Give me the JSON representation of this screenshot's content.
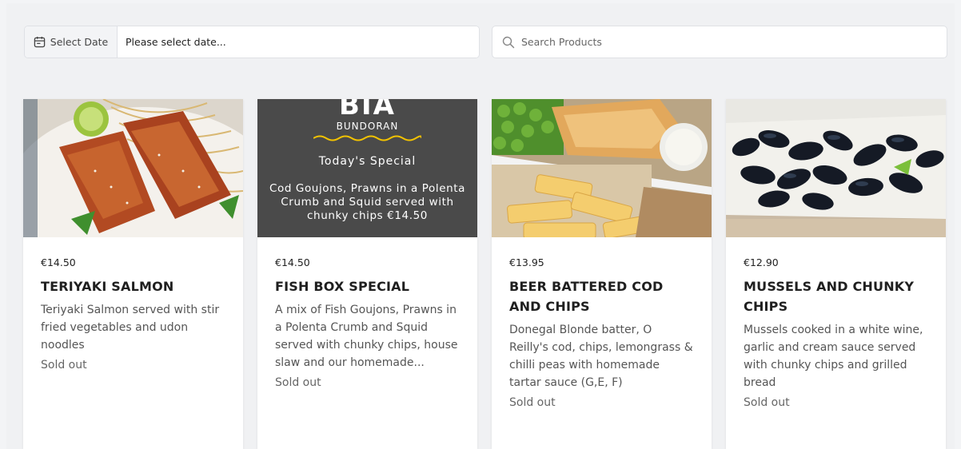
{
  "toolbar": {
    "date_label": "Select Date",
    "date_placeholder": "Please select date...",
    "search_placeholder": "Search Products"
  },
  "products": [
    {
      "price": "€14.50",
      "title": "TERIYAKI SALMON",
      "description": "Teriyaki Salmon served with stir fried vegetables and udon noodles",
      "status": "Sold out"
    },
    {
      "price": "€14.50",
      "title": "FISH BOX SPECIAL",
      "description": "A mix of Fish Goujons, Prawns in a Polenta Crumb and Squid served with chunky chips, house slaw and our homemade...",
      "status": "Sold out",
      "image_text": {
        "logo": "BIA",
        "location": "BUNDORAN",
        "heading": "Today's Special",
        "body": "Cod Goujons, Prawns in a Polenta Crumb and Squid served with chunky chips €14.50"
      }
    },
    {
      "price": "€13.95",
      "title": "BEER BATTERED COD AND CHIPS",
      "description": "Donegal Blonde batter, O Reilly's cod, chips, lemongrass & chilli peas with homemade tartar sauce (G,E, F)",
      "status": "Sold out"
    },
    {
      "price": "€12.90",
      "title": "MUSSELS AND CHUNKY CHIPS",
      "description": "Mussels cooked in a white wine, garlic and cream sauce served with chunky chips and grilled bread",
      "status": "Sold out"
    }
  ],
  "colors": {
    "page_bg": "#f0f1f3",
    "card_bg": "#ffffff",
    "special_board": "#4a4a4a",
    "wave_yellow": "#f2c200"
  },
  "icons": [
    "calendar-icon",
    "search-icon"
  ]
}
